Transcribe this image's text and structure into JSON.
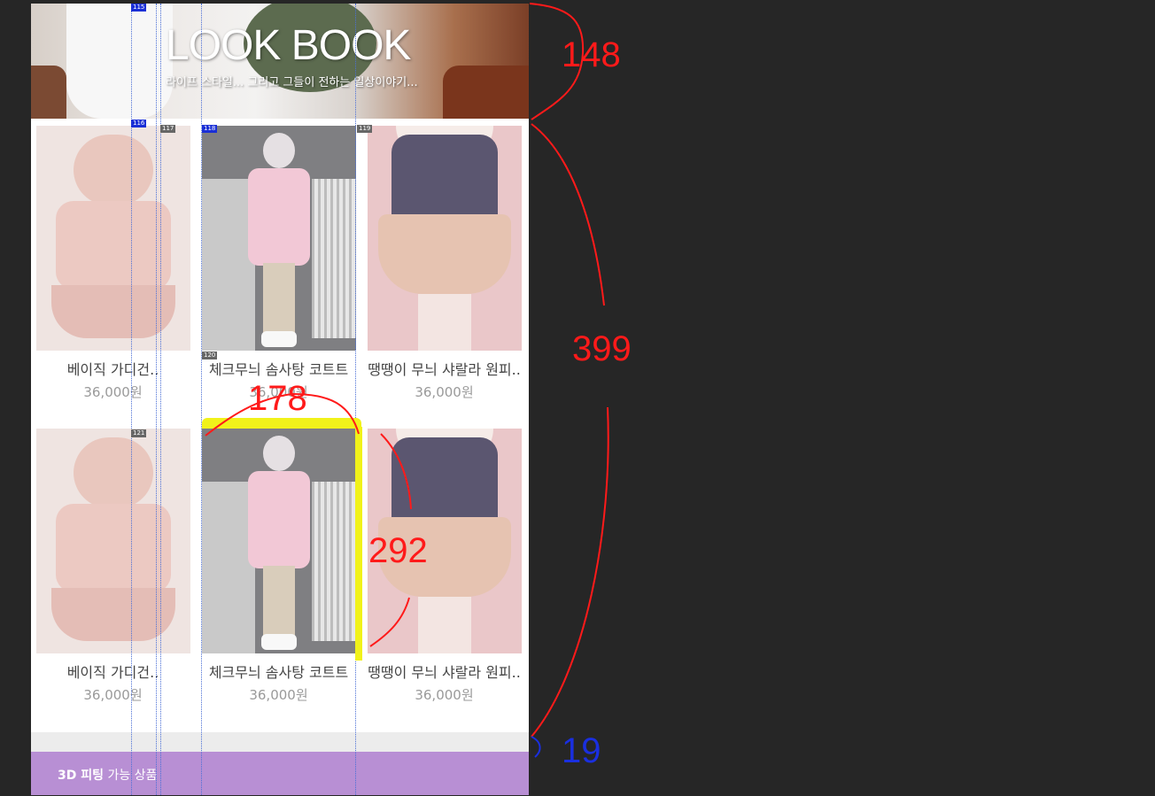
{
  "banner": {
    "title": "LOOK BOOK",
    "subtitle": "라이프 스타일... 그리고 그들이 전하는 일상이야기..."
  },
  "products": [
    {
      "name": "베이직 가디건..",
      "price": "36,000원",
      "image": "cardigan"
    },
    {
      "name": "체크무늬 솜사탕 코트트",
      "price": "36,000원",
      "image": "coat"
    },
    {
      "name": "땡땡이 무늬 샤랄라 원피..",
      "price": "36,000원",
      "image": "skirt"
    },
    {
      "name": "베이직 가디건..",
      "price": "36,000원",
      "image": "cardigan"
    },
    {
      "name": "체크무늬 솜사탕 코트트",
      "price": "36,000원",
      "image": "coat"
    },
    {
      "name": "땡땡이 무늬 샤랄라 원피..",
      "price": "36,000원",
      "image": "skirt"
    }
  ],
  "footer": {
    "bold": "3D 피팅",
    "rest": " 가능 상품"
  },
  "annotations": {
    "a148": "148",
    "a399": "399",
    "a19": "19",
    "a178": "178",
    "a292": "292"
  },
  "tags": {
    "t115": "115",
    "t116": "116",
    "t117": "117",
    "t118": "118",
    "t119": "119",
    "t120": "120",
    "t121": "121"
  },
  "colors": {
    "background": "#262626",
    "footer_bar": "#b88fd4",
    "annotation_red": "#ff1a1a",
    "annotation_blue": "#1a2fe0",
    "highlight": "#f1f21a"
  }
}
